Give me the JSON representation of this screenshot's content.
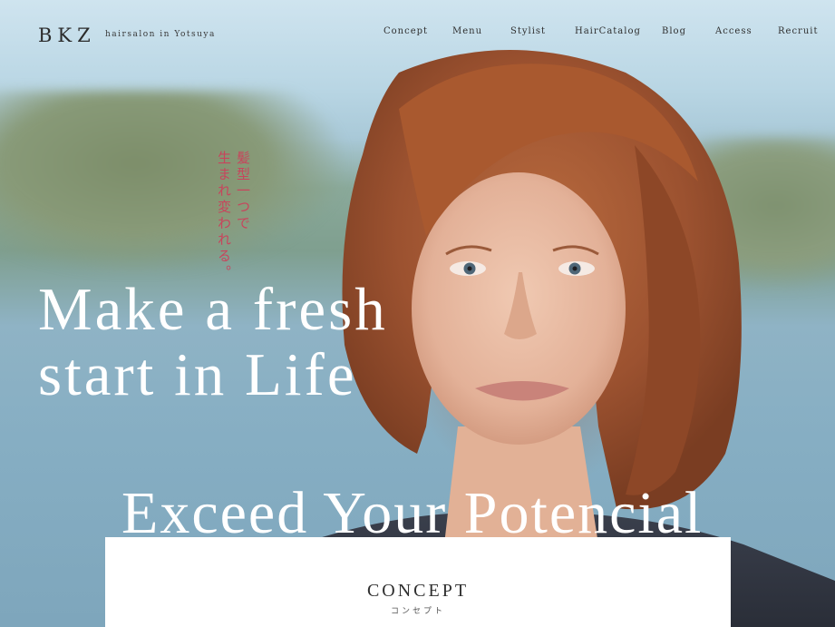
{
  "header": {
    "logo": "BKZ",
    "tagline": "hairsalon in Yotsuya"
  },
  "nav": {
    "items": [
      "Concept",
      "Menu",
      "Stylist",
      "HairCatalog",
      "Blog",
      "Access",
      "Recruit"
    ]
  },
  "hero": {
    "catch_jp": [
      "髪型一つで",
      "生まれ変われる。"
    ],
    "headline": [
      "Make a fresh",
      "start in Life"
    ],
    "caption": "Exceed Your Potencial"
  },
  "concept": {
    "title": "CONCEPT",
    "subtitle": "コンセプト"
  },
  "colors": {
    "accent_pink": "#c8445c",
    "text_dark": "#2f2f2f",
    "card_bg": "#ffffff"
  }
}
